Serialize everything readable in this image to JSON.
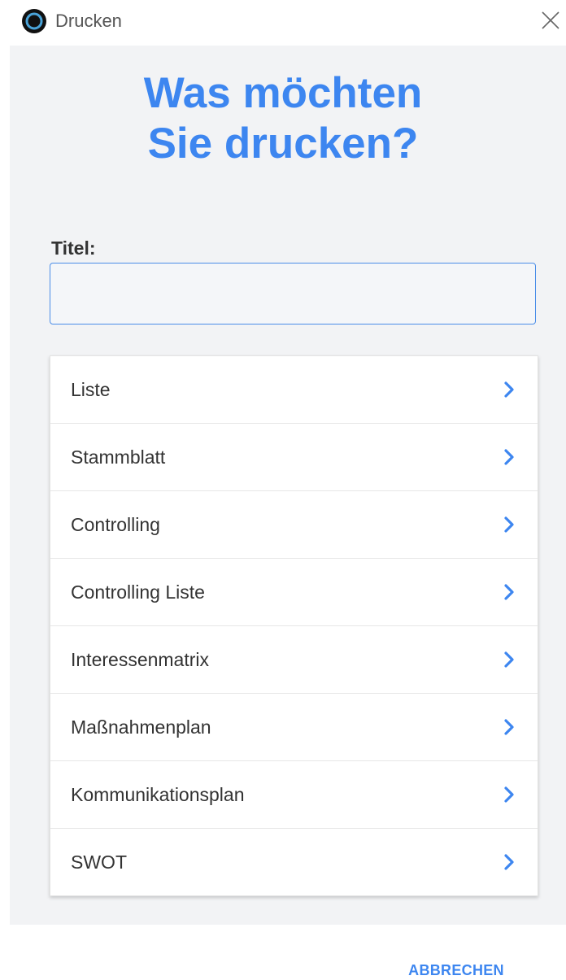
{
  "window": {
    "title": "Drucken",
    "app_icon": "app-logo-icon",
    "close_icon": "close-icon"
  },
  "heading": {
    "line1": "Was möchten",
    "line2": "Sie drucken?"
  },
  "title_field": {
    "label": "Titel:",
    "value": "",
    "placeholder": ""
  },
  "options": [
    {
      "label": "Liste",
      "icon": "chevron-right-icon"
    },
    {
      "label": "Stammblatt",
      "icon": "chevron-right-icon"
    },
    {
      "label": "Controlling",
      "icon": "chevron-right-icon"
    },
    {
      "label": "Controlling Liste",
      "icon": "chevron-right-icon"
    },
    {
      "label": "Interessenmatrix",
      "icon": "chevron-right-icon"
    },
    {
      "label": "Maßnahmenplan",
      "icon": "chevron-right-icon"
    },
    {
      "label": "Kommunikationsplan",
      "icon": "chevron-right-icon"
    },
    {
      "label": "SWOT",
      "icon": "chevron-right-icon"
    }
  ],
  "footer": {
    "cancel_label": "ABBRECHEN"
  },
  "colors": {
    "accent": "#3d86f0",
    "panel_background": "#f2f3f5",
    "text": "#333333"
  }
}
